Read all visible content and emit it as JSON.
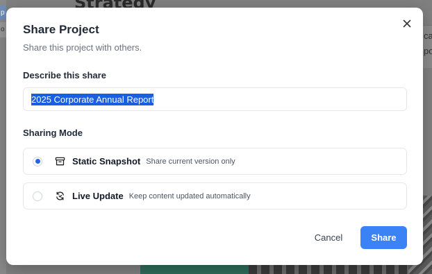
{
  "background": {
    "heading": "Strategy",
    "left_snippet_1": "p",
    "left_snippet_2": "o",
    "right_snippet_1": "cal",
    "right_snippet_2": "po"
  },
  "dialog": {
    "title": "Share Project",
    "subtitle": "Share this project with others.",
    "close_icon": "×",
    "describe_label": "Describe this share",
    "describe_value": "2025 Corporate Annual Report",
    "mode_label": "Sharing Mode",
    "options": [
      {
        "name": "Static Snapshot",
        "description": "Share current version only",
        "icon": "archive-icon",
        "selected": true
      },
      {
        "name": "Live Update",
        "description": "Keep content updated automatically",
        "icon": "sync-icon",
        "selected": false
      }
    ],
    "cancel_label": "Cancel",
    "share_label": "Share"
  },
  "colors": {
    "accent": "#3b82f6",
    "selection": "#1a5fe0",
    "overlay": "#808080"
  }
}
